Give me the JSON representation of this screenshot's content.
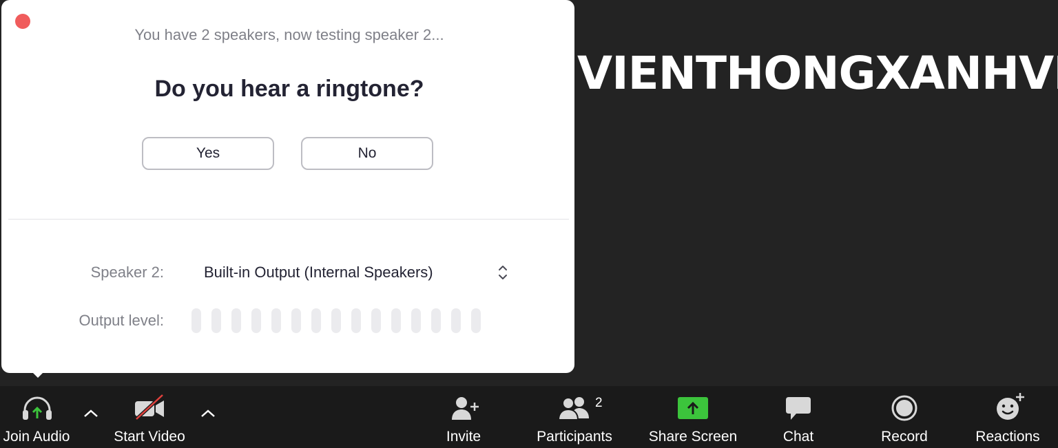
{
  "dialog": {
    "status_text": "You have 2 speakers, now testing speaker 2...",
    "question": "Do you hear a ringtone?",
    "yes_label": "Yes",
    "no_label": "No",
    "speaker_label": "Speaker 2:",
    "speaker_value": "Built-in Output (Internal Speakers)",
    "output_level_label": "Output level:",
    "output_level": 0,
    "output_level_segments": 15
  },
  "watermark": "VIENTHONGXANHVN",
  "toolbar": {
    "join_audio": "Join Audio",
    "start_video": "Start Video",
    "invite": "Invite",
    "participants": "Participants",
    "participants_count": "2",
    "share_screen": "Share Screen",
    "chat": "Chat",
    "record": "Record",
    "reactions": "Reactions"
  },
  "icons": [
    "close-icon",
    "up-down-chevron-icon",
    "headphones-arrow-icon",
    "chevron-up-icon",
    "video-off-icon",
    "add-user-icon",
    "participants-icon",
    "share-screen-icon",
    "chat-icon",
    "record-icon",
    "reactions-icon"
  ],
  "colors": {
    "close": "#f05c5c",
    "share_green": "#3cc43c",
    "headphone_arrow_green": "#3cc43c",
    "video_off_red": "#e0403c",
    "toolbar_bg": "#1a1a1a",
    "page_bg": "#232323"
  }
}
